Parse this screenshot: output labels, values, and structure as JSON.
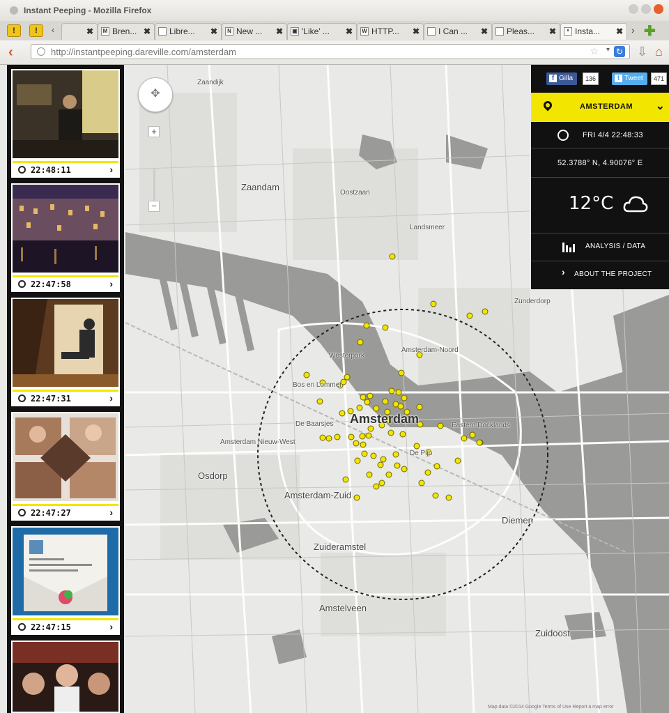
{
  "window": {
    "title": "Instant Peeping - Mozilla Firefox"
  },
  "tabs": [
    {
      "label": "Bren...",
      "icon": "m-icon"
    },
    {
      "label": "Libre...",
      "icon": "page-icon"
    },
    {
      "label": "New ...",
      "icon": "n-icon"
    },
    {
      "label": "'Like' ...",
      "icon": "image-icon"
    },
    {
      "label": "HTTP...",
      "icon": "w-icon"
    },
    {
      "label": "I Can ...",
      "icon": "page-icon"
    },
    {
      "label": "Pleas...",
      "icon": "page-icon"
    },
    {
      "label": "Insta...",
      "icon": "eye-icon"
    }
  ],
  "nav": {
    "url": "http://instantpeeping.dareville.com/amsterdam"
  },
  "sidebar": {
    "items": [
      {
        "time": "22:48:11"
      },
      {
        "time": "22:47:58"
      },
      {
        "time": "22:47:31"
      },
      {
        "time": "22:47:27"
      },
      {
        "time": "22:47:15"
      }
    ]
  },
  "panel": {
    "facebook_label": "Gilla",
    "facebook_count": "136",
    "tweet_label": "Tweet",
    "tweet_count": "471",
    "city": "AMSTERDAM",
    "datetime": "FRI 4/4 22:48:33",
    "coordinates": "52.3788° N, 4.90076° E",
    "temperature": "12°C",
    "analysis_label": "ANALYSIS / DATA",
    "about_label": "ABOUT THE PROJECT"
  },
  "map": {
    "labels": {
      "zaandam": "Zaandam",
      "amsterdam": "Amsterdam",
      "westerpark": "Westerpark",
      "amsterdam_noord": "Amsterdam-Noord",
      "de_baarsjes": "De Baarsjes",
      "amsterdam_zuid": "Amsterdam-Zuid",
      "amstelveen": "Amstelveen",
      "diemen": "Diemen",
      "zuidoost": "Zuidoost",
      "zuidasmstel": "Zuideramstel",
      "osdorp": "Osdorp",
      "de_pijp": "De Pijp",
      "bos_en_lommer": "Bos en Lommer",
      "oostzaan": "Oostzaan",
      "landsmeer": "Landsmeer",
      "amsterdam_nieuw_west": "Amsterdam Nieuw-West",
      "oostelijk_havengebied": "Eastern Docklands",
      "zunderdorp": "Zunderdorp"
    },
    "copyright": "Map data ©2014 Google  Terms of Use  Report a map error"
  },
  "colors": {
    "accent": "#f2e600",
    "panel": "#111111",
    "marker": "#f2e600"
  }
}
